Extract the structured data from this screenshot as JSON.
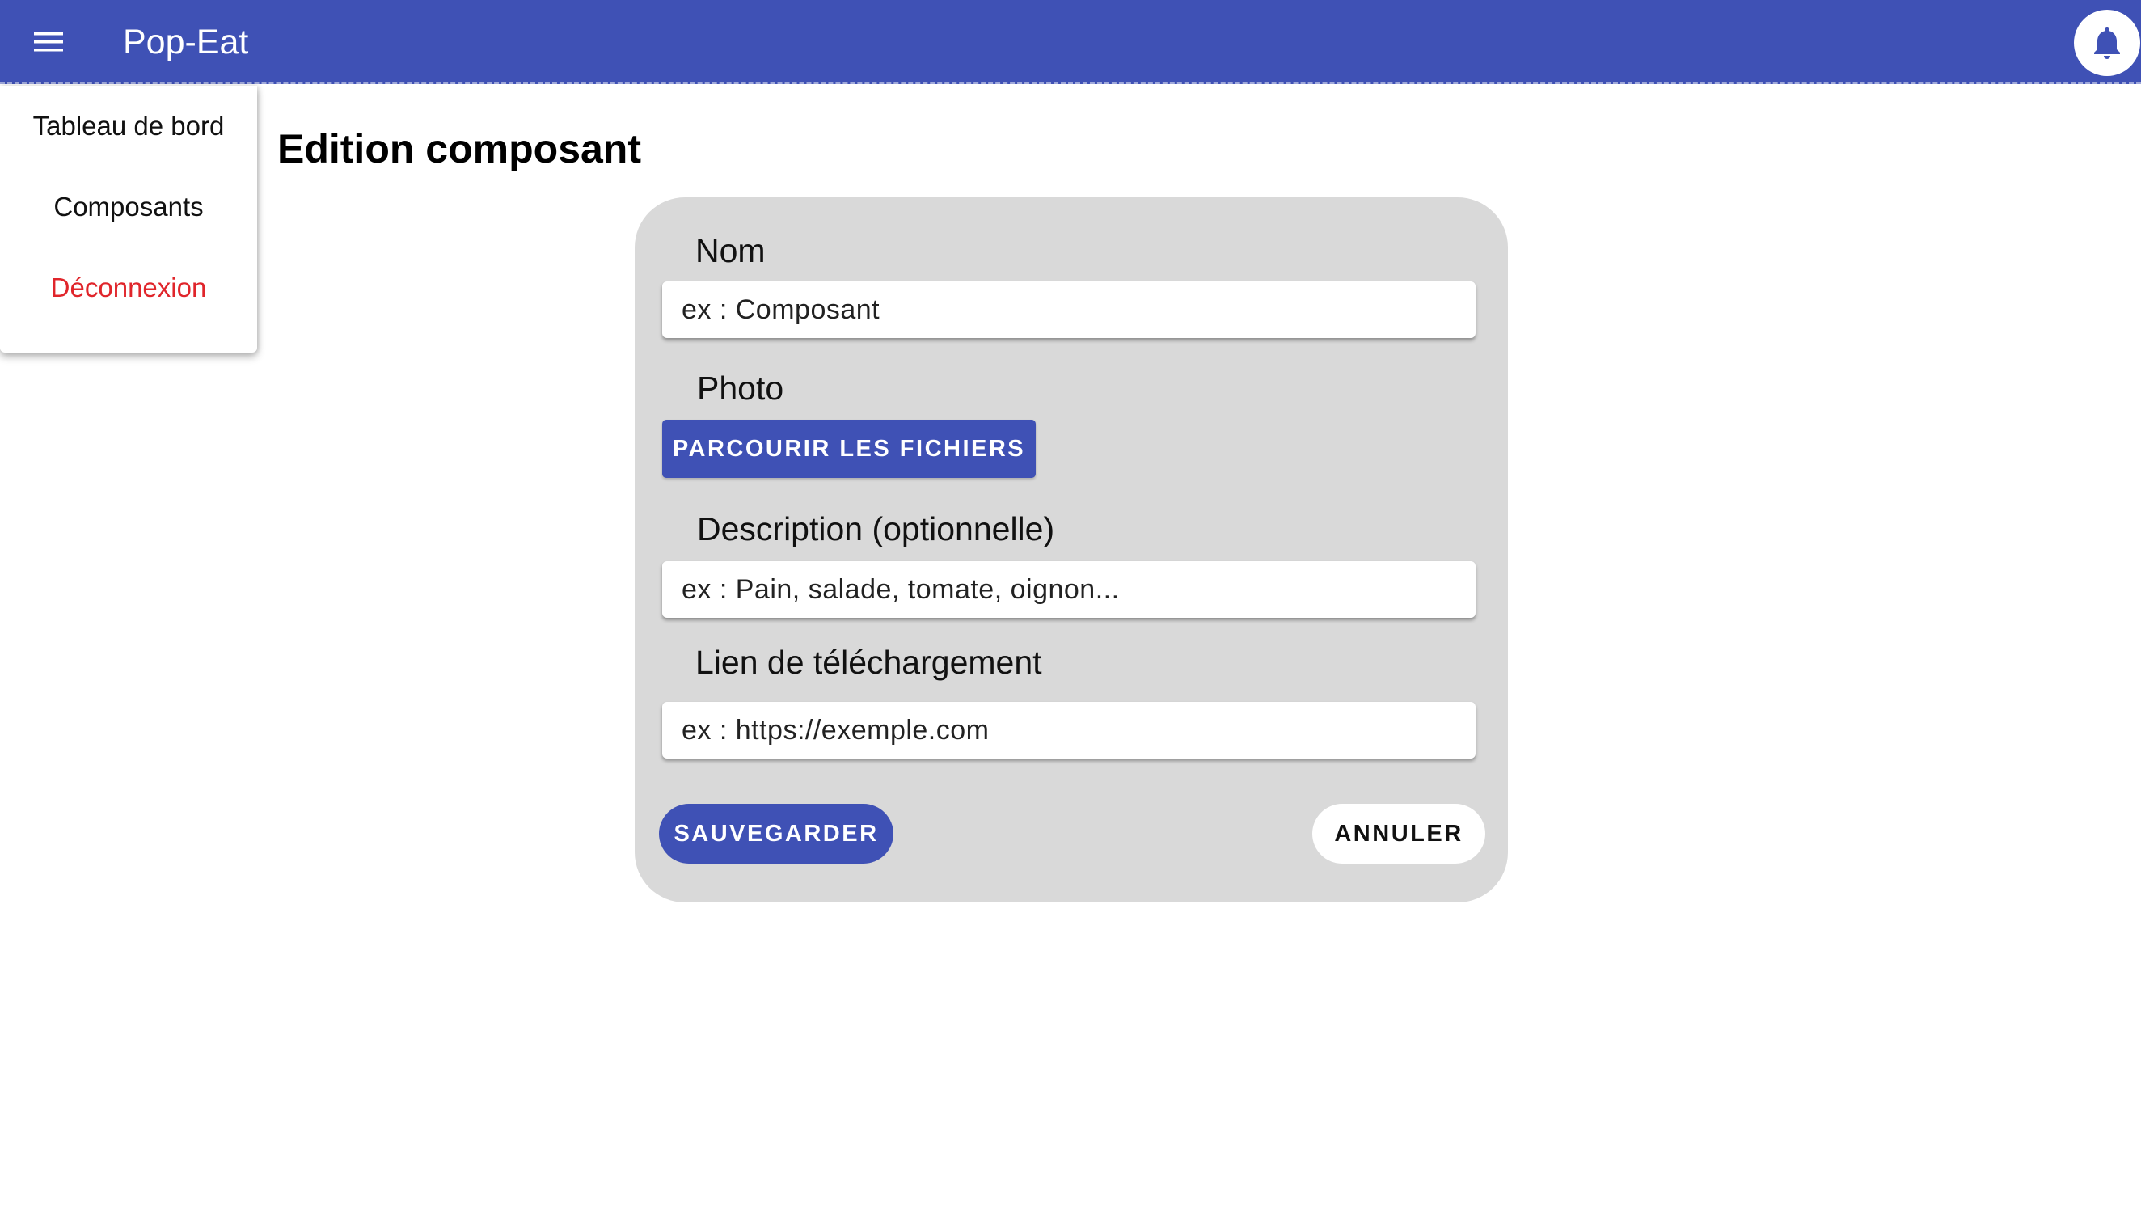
{
  "app": {
    "title": "Pop-Eat",
    "menu_icon": "hamburger-menu-icon",
    "notification_icon": "bell-icon",
    "brand_color": "#3f51b5"
  },
  "side_menu": {
    "items": [
      {
        "label": "Tableau de bord"
      },
      {
        "label": "Composants"
      },
      {
        "label": "Déconnexion",
        "color": "#e0252b"
      }
    ]
  },
  "page": {
    "title": "Edition composant"
  },
  "form": {
    "name": {
      "label": "Nom",
      "placeholder": "ex : Composant"
    },
    "photo": {
      "label": "Photo",
      "button": "PARCOURIR LES FICHIERS"
    },
    "description": {
      "label": "Description (optionnelle)",
      "placeholder": "ex : Pain, salade, tomate, oignon..."
    },
    "download_link": {
      "label": "Lien de téléchargement",
      "placeholder": "ex : https://exemple.com"
    },
    "save_label": "SAUVEGARDER",
    "cancel_label": "ANNULER"
  }
}
